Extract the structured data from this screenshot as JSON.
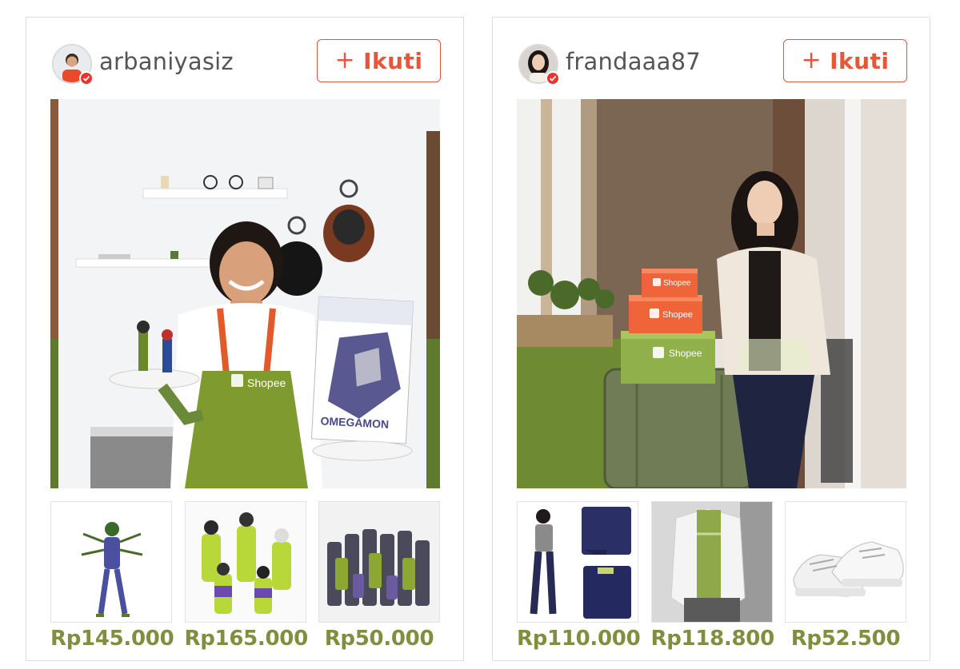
{
  "cards": [
    {
      "username": "arbaniyasiz",
      "follow_label": "Ikuti",
      "follow_prefix": "+",
      "hero_alt": "",
      "products": [
        {
          "price": "Rp145.000"
        },
        {
          "price": "Rp165.000"
        },
        {
          "price": "Rp50.000"
        }
      ]
    },
    {
      "username": "frandaaa87",
      "follow_label": "Ikuti",
      "follow_prefix": "+",
      "products": [
        {
          "price": "Rp110.000"
        },
        {
          "price": "Rp118.800"
        },
        {
          "price": "Rp52.500"
        }
      ]
    }
  ],
  "brand": {
    "shopee_text": "Shopee",
    "box_text": "OMEGAMON"
  },
  "colors": {
    "accent": "#e8563a",
    "price": "#7f8f3e",
    "verified": "#e8352b",
    "shopee_green": "#7a9a2e",
    "shopee_orange": "#f0643a"
  },
  "icons": {
    "verified": "check-badge-icon",
    "follow": "plus-icon"
  }
}
